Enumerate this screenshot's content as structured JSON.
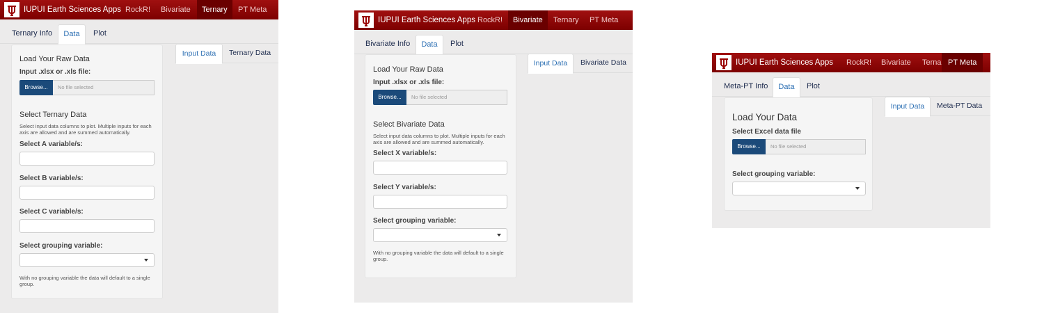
{
  "brand": "IUPUI Earth Sciences Apps",
  "colors": {
    "navbar": "#8b0000",
    "active_nav": "#6a0000",
    "browse_button": "#1b4a7a",
    "link": "#2c6fb3"
  },
  "logo_icon": "iu-trident-icon",
  "screens": [
    {
      "nav": [
        "RockR!",
        "Bivariate",
        "Ternary",
        "PT Meta"
      ],
      "active_nav": "Ternary",
      "tabs": [
        "Ternary Info",
        "Data",
        "Plot"
      ],
      "active_tab": "Data",
      "well": {
        "title": "Load Your Raw Data",
        "file_label": "Input .xlsx or .xls file:",
        "browse": "Browse...",
        "file_placeholder": "No file selected",
        "select_title": "Select Ternary Data",
        "help": "Select input data columns to plot. Multiple inputs for each axis are allowed and are summed automatically.",
        "vars": [
          "Select A variable/s:",
          "Select B variable/s:",
          "Select C variable/s:"
        ],
        "group_label": "Select grouping variable:",
        "group_note": "With no grouping variable the data will default to a single group."
      },
      "output_tabs": [
        "Input Data",
        "Ternary Data"
      ]
    },
    {
      "nav": [
        "RockR!",
        "Bivariate",
        "Ternary",
        "PT Meta"
      ],
      "active_nav": "Bivariate",
      "tabs": [
        "Bivariate Info",
        "Data",
        "Plot"
      ],
      "active_tab": "Data",
      "well": {
        "title": "Load Your Raw Data",
        "file_label": "Input .xlsx or .xls file:",
        "browse": "Browse...",
        "file_placeholder": "No file selected",
        "select_title": "Select Bivariate Data",
        "help": "Select input data columns to plot. Multiple inputs for each axis are allowed and are summed automatically.",
        "vars": [
          "Select X variable/s:",
          "Select Y variable/s:"
        ],
        "group_label": "Select grouping variable:",
        "group_note": "With no grouping variable the data will default to a single group."
      },
      "output_tabs": [
        "Input Data",
        "Bivariate Data"
      ]
    },
    {
      "nav": [
        "RockR!",
        "Bivariate",
        "Ternary",
        "PT Meta"
      ],
      "active_nav": "PT Meta",
      "tabs": [
        "Meta-PT Info",
        "Data",
        "Plot"
      ],
      "active_tab": "Data",
      "well": {
        "title": "Load Your Data",
        "file_label": "Select Excel data file",
        "browse": "Browse...",
        "file_placeholder": "No file selected",
        "group_label": "Select grouping variable:"
      },
      "output_tabs": [
        "Input Data",
        "Meta-PT Data"
      ]
    }
  ]
}
